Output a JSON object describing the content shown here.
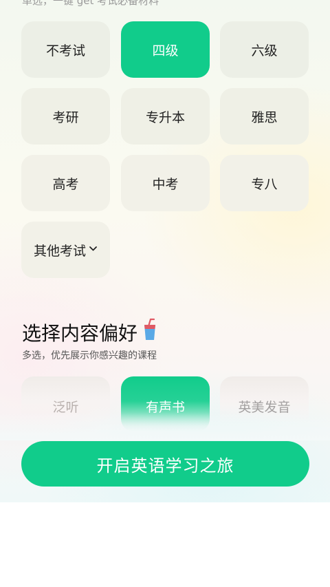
{
  "top_hint": "单选，一键 get 考试必备材料",
  "exam_options": [
    {
      "label": "不考试",
      "selected": false
    },
    {
      "label": "四级",
      "selected": true
    },
    {
      "label": "六级",
      "selected": false
    },
    {
      "label": "考研",
      "selected": false
    },
    {
      "label": "专升本",
      "selected": false
    },
    {
      "label": "雅思",
      "selected": false
    },
    {
      "label": "高考",
      "selected": false
    },
    {
      "label": "中考",
      "selected": false
    },
    {
      "label": "专八",
      "selected": false
    },
    {
      "label": "其他考试",
      "selected": false,
      "icon": "chevron-down-icon"
    }
  ],
  "preference_section": {
    "title": "选择内容偏好",
    "title_icon": "drink-cup-icon",
    "subtitle": "多选，优先展示你感兴趣的课程",
    "options": [
      {
        "label": "泛听",
        "selected": false
      },
      {
        "label": "有声书",
        "selected": true
      },
      {
        "label": "英美发音",
        "selected": false
      }
    ]
  },
  "start_button": {
    "label": "开启英语学习之旅"
  },
  "colors": {
    "accent": "#11cc8b",
    "chip_bg": "#ecefe6"
  }
}
